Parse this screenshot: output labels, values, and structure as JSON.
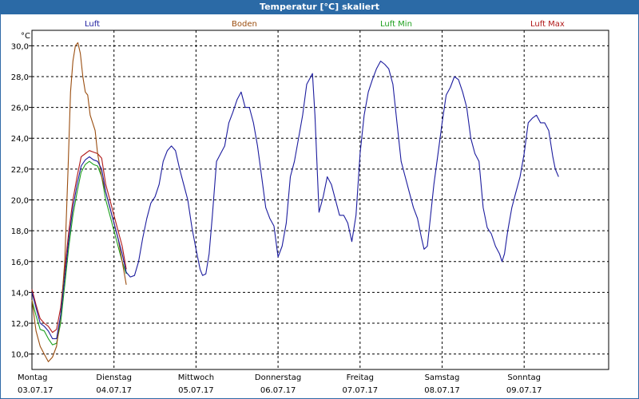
{
  "window": {
    "title": "Temperatur [°C] skaliert"
  },
  "colors": {
    "titlebar": "#2b6aa6",
    "luft": "#1c1c9e",
    "boden": "#9a4d0f",
    "luftmin": "#1ea01e",
    "luftmax": "#b01818"
  },
  "chart_data": {
    "type": "line",
    "title": "Temperatur [°C] skaliert",
    "ylabel": "°C",
    "ylim": [
      9.0,
      31.0
    ],
    "yticks": [
      "10,0",
      "12,0",
      "14,0",
      "16,0",
      "18,0",
      "20,0",
      "22,0",
      "24,0",
      "26,0",
      "28,0",
      "30,0"
    ],
    "days": [
      {
        "weekday": "Montag",
        "date": "03.07.17"
      },
      {
        "weekday": "Dienstag",
        "date": "04.07.17"
      },
      {
        "weekday": "Mittwoch",
        "date": "05.07.17"
      },
      {
        "weekday": "Donnerstag",
        "date": "06.07.17"
      },
      {
        "weekday": "Freitag",
        "date": "07.07.17"
      },
      {
        "weekday": "Samstag",
        "date": "08.07.17"
      },
      {
        "weekday": "Sonntag",
        "date": "09.07.17"
      }
    ],
    "x_unit": "days since 03.07.17 00:00",
    "grid": true,
    "series": [
      {
        "name": "Luft",
        "color": "#1c1c9e",
        "points": [
          [
            0.0,
            14.0
          ],
          [
            0.05,
            13.0
          ],
          [
            0.1,
            12.0
          ],
          [
            0.15,
            11.8
          ],
          [
            0.2,
            11.5
          ],
          [
            0.25,
            11.0
          ],
          [
            0.3,
            11.0
          ],
          [
            0.35,
            12.5
          ],
          [
            0.4,
            15.0
          ],
          [
            0.45,
            17.5
          ],
          [
            0.5,
            19.5
          ],
          [
            0.55,
            21.0
          ],
          [
            0.6,
            22.2
          ],
          [
            0.65,
            22.6
          ],
          [
            0.7,
            22.8
          ],
          [
            0.75,
            22.6
          ],
          [
            0.8,
            22.5
          ],
          [
            0.85,
            22.0
          ],
          [
            0.9,
            20.5
          ],
          [
            0.95,
            19.5
          ],
          [
            1.0,
            18.5
          ],
          [
            1.05,
            17.5
          ],
          [
            1.1,
            16.5
          ],
          [
            1.15,
            15.3
          ],
          [
            1.2,
            15.0
          ],
          [
            1.25,
            15.1
          ],
          [
            1.3,
            16.0
          ],
          [
            1.35,
            17.5
          ],
          [
            1.4,
            18.8
          ],
          [
            1.45,
            19.8
          ],
          [
            1.5,
            20.2
          ],
          [
            1.55,
            21.0
          ],
          [
            1.6,
            22.5
          ],
          [
            1.65,
            23.2
          ],
          [
            1.7,
            23.5
          ],
          [
            1.75,
            23.2
          ],
          [
            1.8,
            22.0
          ],
          [
            1.85,
            21.0
          ],
          [
            1.9,
            20.0
          ],
          [
            1.95,
            18.2
          ],
          [
            2.0,
            16.8
          ],
          [
            2.05,
            15.5
          ],
          [
            2.08,
            15.1
          ],
          [
            2.12,
            15.2
          ],
          [
            2.16,
            16.5
          ],
          [
            2.2,
            19.0
          ],
          [
            2.25,
            22.5
          ],
          [
            2.3,
            23.0
          ],
          [
            2.35,
            23.5
          ],
          [
            2.4,
            25.0
          ],
          [
            2.45,
            25.7
          ],
          [
            2.5,
            26.5
          ],
          [
            2.55,
            27.0
          ],
          [
            2.6,
            26.0
          ],
          [
            2.65,
            26.0
          ],
          [
            2.7,
            25.0
          ],
          [
            2.75,
            23.5
          ],
          [
            2.8,
            21.5
          ],
          [
            2.85,
            19.5
          ],
          [
            2.9,
            18.8
          ],
          [
            2.95,
            18.3
          ],
          [
            3.0,
            16.3
          ],
          [
            3.05,
            17.0
          ],
          [
            3.1,
            18.5
          ],
          [
            3.15,
            21.5
          ],
          [
            3.2,
            22.5
          ],
          [
            3.25,
            24.0
          ],
          [
            3.3,
            25.5
          ],
          [
            3.35,
            27.5
          ],
          [
            3.4,
            28.0
          ],
          [
            3.42,
            28.2
          ],
          [
            3.45,
            25.5
          ],
          [
            3.5,
            19.2
          ],
          [
            3.55,
            20.2
          ],
          [
            3.6,
            21.5
          ],
          [
            3.65,
            21.0
          ],
          [
            3.7,
            20.0
          ],
          [
            3.75,
            19.0
          ],
          [
            3.8,
            19.0
          ],
          [
            3.85,
            18.5
          ],
          [
            3.9,
            17.3
          ],
          [
            3.95,
            19.0
          ],
          [
            4.0,
            23.0
          ],
          [
            4.05,
            25.5
          ],
          [
            4.1,
            27.0
          ],
          [
            4.15,
            27.8
          ],
          [
            4.2,
            28.5
          ],
          [
            4.25,
            29.0
          ],
          [
            4.3,
            28.8
          ],
          [
            4.35,
            28.5
          ],
          [
            4.4,
            27.5
          ],
          [
            4.45,
            25.0
          ],
          [
            4.5,
            22.5
          ],
          [
            4.55,
            21.5
          ],
          [
            4.6,
            20.5
          ],
          [
            4.65,
            19.5
          ],
          [
            4.7,
            18.8
          ],
          [
            4.75,
            17.5
          ],
          [
            4.78,
            16.8
          ],
          [
            4.82,
            17.0
          ],
          [
            4.85,
            18.5
          ],
          [
            4.9,
            21.0
          ],
          [
            4.95,
            23.0
          ],
          [
            5.0,
            25.0
          ],
          [
            5.05,
            26.8
          ],
          [
            5.1,
            27.3
          ],
          [
            5.15,
            28.0
          ],
          [
            5.2,
            27.8
          ],
          [
            5.25,
            27.0
          ],
          [
            5.3,
            26.0
          ],
          [
            5.35,
            24.0
          ],
          [
            5.4,
            23.0
          ],
          [
            5.45,
            22.5
          ],
          [
            5.5,
            19.5
          ],
          [
            5.55,
            18.2
          ],
          [
            5.6,
            17.8
          ],
          [
            5.65,
            17.0
          ],
          [
            5.7,
            16.5
          ],
          [
            5.73,
            16.0
          ],
          [
            5.76,
            16.5
          ],
          [
            5.8,
            18.0
          ],
          [
            5.85,
            19.5
          ],
          [
            5.9,
            20.5
          ],
          [
            5.95,
            21.5
          ],
          [
            6.0,
            23.0
          ],
          [
            6.05,
            25.0
          ],
          [
            6.1,
            25.3
          ],
          [
            6.15,
            25.5
          ],
          [
            6.2,
            25.0
          ],
          [
            6.25,
            25.0
          ],
          [
            6.3,
            24.5
          ],
          [
            6.35,
            22.8
          ],
          [
            6.38,
            22.0
          ],
          [
            6.42,
            21.5
          ]
        ]
      },
      {
        "name": "Boden",
        "color": "#9a4d0f",
        "points": [
          [
            0.0,
            13.5
          ],
          [
            0.05,
            11.5
          ],
          [
            0.1,
            10.5
          ],
          [
            0.15,
            10.0
          ],
          [
            0.2,
            9.5
          ],
          [
            0.25,
            9.8
          ],
          [
            0.3,
            10.5
          ],
          [
            0.35,
            12.5
          ],
          [
            0.4,
            16.0
          ],
          [
            0.44,
            22.0
          ],
          [
            0.47,
            27.0
          ],
          [
            0.5,
            29.0
          ],
          [
            0.53,
            30.0
          ],
          [
            0.56,
            30.2
          ],
          [
            0.59,
            29.5
          ],
          [
            0.62,
            28.0
          ],
          [
            0.65,
            27.0
          ],
          [
            0.68,
            26.8
          ],
          [
            0.71,
            25.5
          ],
          [
            0.74,
            25.0
          ],
          [
            0.77,
            24.5
          ],
          [
            0.8,
            23.0
          ],
          [
            0.85,
            21.5
          ],
          [
            0.9,
            20.5
          ],
          [
            0.95,
            19.5
          ],
          [
            1.0,
            18.5
          ],
          [
            1.05,
            17.5
          ],
          [
            1.1,
            16.0
          ],
          [
            1.15,
            14.5
          ]
        ]
      },
      {
        "name": "Luft Min",
        "color": "#1ea01e",
        "points": [
          [
            0.0,
            13.5
          ],
          [
            0.05,
            12.5
          ],
          [
            0.1,
            11.6
          ],
          [
            0.15,
            11.5
          ],
          [
            0.2,
            11.0
          ],
          [
            0.25,
            10.6
          ],
          [
            0.3,
            10.7
          ],
          [
            0.35,
            12.0
          ],
          [
            0.4,
            14.5
          ],
          [
            0.45,
            17.0
          ],
          [
            0.5,
            19.0
          ],
          [
            0.55,
            20.5
          ],
          [
            0.6,
            21.8
          ],
          [
            0.65,
            22.3
          ],
          [
            0.7,
            22.5
          ],
          [
            0.75,
            22.3
          ],
          [
            0.8,
            22.2
          ],
          [
            0.85,
            21.5
          ],
          [
            0.9,
            20.0
          ],
          [
            0.95,
            19.0
          ],
          [
            1.0,
            18.0
          ],
          [
            1.05,
            17.0
          ],
          [
            1.1,
            16.0
          ],
          [
            1.15,
            15.2
          ]
        ]
      },
      {
        "name": "Luft Max",
        "color": "#b01818",
        "points": [
          [
            0.0,
            14.2
          ],
          [
            0.05,
            13.2
          ],
          [
            0.1,
            12.3
          ],
          [
            0.15,
            12.0
          ],
          [
            0.2,
            11.8
          ],
          [
            0.25,
            11.4
          ],
          [
            0.3,
            11.6
          ],
          [
            0.35,
            13.0
          ],
          [
            0.4,
            15.5
          ],
          [
            0.45,
            18.0
          ],
          [
            0.5,
            20.0
          ],
          [
            0.55,
            21.5
          ],
          [
            0.6,
            22.8
          ],
          [
            0.65,
            23.0
          ],
          [
            0.7,
            23.2
          ],
          [
            0.75,
            23.1
          ],
          [
            0.8,
            23.0
          ],
          [
            0.85,
            22.7
          ],
          [
            0.9,
            21.0
          ],
          [
            0.95,
            20.0
          ],
          [
            1.0,
            19.0
          ],
          [
            1.05,
            18.0
          ],
          [
            1.1,
            17.0
          ],
          [
            1.15,
            15.5
          ]
        ]
      }
    ]
  }
}
